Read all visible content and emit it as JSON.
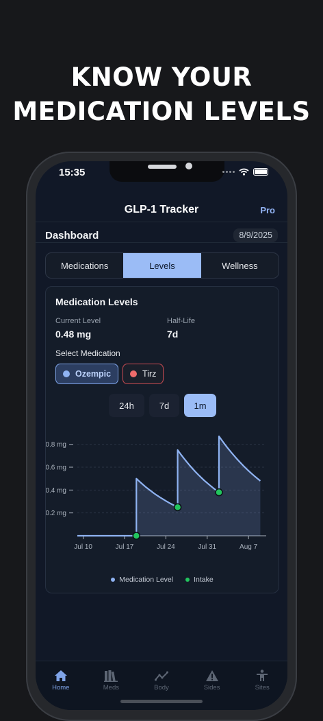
{
  "headline": {
    "line1": "KNOW YOUR",
    "line2": "MEDICATION LEVELS"
  },
  "status": {
    "time": "15:35"
  },
  "nav": {
    "title": "GLP-1 Tracker",
    "pro": "Pro"
  },
  "dashboard": {
    "title": "Dashboard",
    "date": "8/9/2025"
  },
  "tabs": [
    {
      "label": "Medications",
      "active": false
    },
    {
      "label": "Levels",
      "active": true
    },
    {
      "label": "Wellness",
      "active": false
    }
  ],
  "card": {
    "title": "Medication Levels",
    "current_label": "Current Level",
    "current_value": "0.48 mg",
    "halflife_label": "Half-Life",
    "halflife_value": "7d",
    "select_label": "Select Medication",
    "medications": [
      {
        "label": "Ozempic",
        "selected": true,
        "color": "#8fb3f2"
      },
      {
        "label": "Tirz",
        "selected": false,
        "color": "#ef6b6b"
      }
    ],
    "ranges": [
      {
        "label": "24h",
        "active": false
      },
      {
        "label": "7d",
        "active": false
      },
      {
        "label": "1m",
        "active": true
      }
    ]
  },
  "chart_data": {
    "type": "area",
    "x_ticks": [
      "Jul 10",
      "Jul 17",
      "Jul 24",
      "Jul 31",
      "Aug 7"
    ],
    "y_ticks": [
      "0.2 mg",
      "0.4 mg",
      "0.6 mg",
      "0.8 mg"
    ],
    "ylim": [
      0,
      0.9
    ],
    "xlim_days": [
      0,
      31
    ],
    "x_start": "Jul 10",
    "series": [
      {
        "name": "Medication Level",
        "color": "#8fb3f2",
        "points": [
          [
            "Jul 9",
            0
          ],
          [
            "Jul 19",
            0
          ],
          [
            "Jul 19",
            0.5
          ],
          [
            "Jul 26",
            0.25
          ],
          [
            "Jul 26",
            0.75
          ],
          [
            "Aug 2",
            0.38
          ],
          [
            "Aug 2",
            0.87
          ],
          [
            "Aug 9",
            0.48
          ]
        ]
      },
      {
        "name": "Intake",
        "color": "#22c55e",
        "points": [
          [
            "Jul 19",
            0
          ],
          [
            "Jul 26",
            0.25
          ],
          [
            "Aug 2",
            0.38
          ]
        ]
      }
    ],
    "legend": [
      "Medication Level",
      "Intake"
    ],
    "grid": true
  },
  "tabbar": [
    {
      "label": "Home",
      "icon": "home-icon",
      "active": true
    },
    {
      "label": "Meds",
      "icon": "books-icon",
      "active": false
    },
    {
      "label": "Body",
      "icon": "trend-icon",
      "active": false
    },
    {
      "label": "Sides",
      "icon": "warning-icon",
      "active": false
    },
    {
      "label": "Sites",
      "icon": "person-icon",
      "active": false
    }
  ]
}
